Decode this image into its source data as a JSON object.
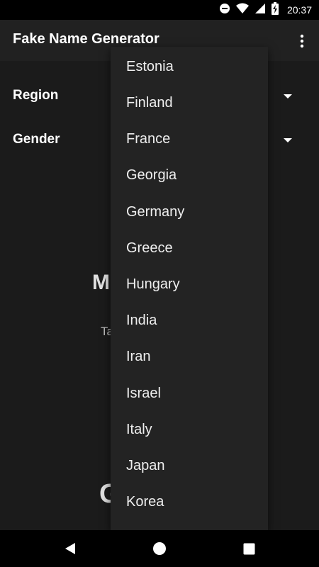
{
  "status_bar": {
    "time": "20:37",
    "icons": [
      "do-not-disturb-icon",
      "wifi-icon",
      "battery-charging-icon"
    ]
  },
  "app_bar": {
    "title": "Fake Name Generator",
    "menu_icon": "more-vert-icon"
  },
  "form": {
    "region_label": "Region",
    "gender_label": "Gender"
  },
  "background_partial": {
    "name_initial": "M",
    "subtitle_initial": "Ta",
    "bottom_initial": "G"
  },
  "dropdown": {
    "items": [
      "Estonia",
      "Finland",
      "France",
      "Georgia",
      "Germany",
      "Greece",
      "Hungary",
      "India",
      "Iran",
      "Israel",
      "Italy",
      "Japan",
      "Korea"
    ]
  },
  "nav_bar": {
    "icons": [
      "back-icon",
      "home-icon",
      "recents-icon"
    ]
  }
}
